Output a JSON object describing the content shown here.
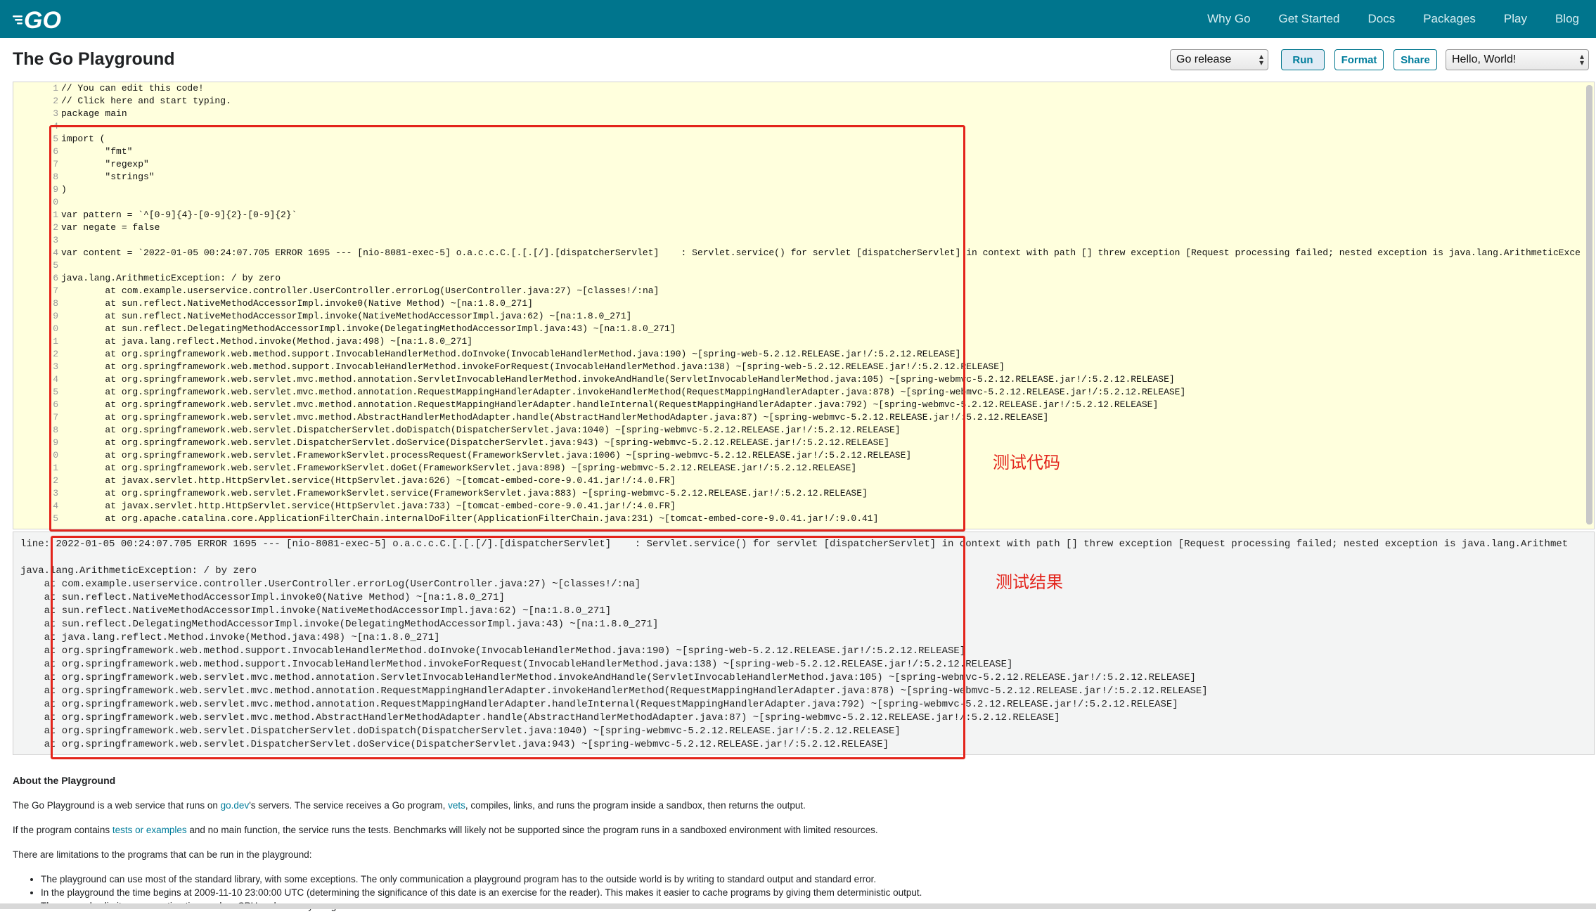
{
  "nav": {
    "logo_text": "GO",
    "items": [
      "Why Go",
      "Get Started",
      "Docs",
      "Packages",
      "Play",
      "Blog"
    ]
  },
  "header": {
    "title": "The Go Playground",
    "release_select": "Go release",
    "run_label": "Run",
    "format_label": "Format",
    "share_label": "Share",
    "example_select": "Hello, World!"
  },
  "editor": {
    "line_numbers": [
      "1",
      "2",
      "3",
      "4",
      "5",
      "6",
      "7",
      "8",
      "9",
      "0",
      "1",
      "2",
      "3",
      "4",
      "5",
      "6",
      "7",
      "8",
      "9",
      "0",
      "1",
      "2",
      "3",
      "4",
      "5",
      "6",
      "7",
      "8",
      "9",
      "0",
      "1",
      "2",
      "3",
      "4",
      "5"
    ],
    "code": "// You can edit this code!\n// Click here and start typing.\npackage main\n\nimport (\n\t\"fmt\"\n\t\"regexp\"\n\t\"strings\"\n)\n\nvar pattern = `^[0-9]{4}-[0-9]{2}-[0-9]{2}`\nvar negate = false\n\nvar content = `2022-01-05 00:24:07.705 ERROR 1695 --- [nio-8081-exec-5] o.a.c.c.C.[.[.[/].[dispatcherServlet]    : Servlet.service() for servlet [dispatcherServlet] in context with path [] threw exception [Request processing failed; nested exception is java.lang.ArithmeticExce\n\njava.lang.ArithmeticException: / by zero\n\tat com.example.userservice.controller.UserController.errorLog(UserController.java:27) ~[classes!/:na]\n\tat sun.reflect.NativeMethodAccessorImpl.invoke0(Native Method) ~[na:1.8.0_271]\n\tat sun.reflect.NativeMethodAccessorImpl.invoke(NativeMethodAccessorImpl.java:62) ~[na:1.8.0_271]\n\tat sun.reflect.DelegatingMethodAccessorImpl.invoke(DelegatingMethodAccessorImpl.java:43) ~[na:1.8.0_271]\n\tat java.lang.reflect.Method.invoke(Method.java:498) ~[na:1.8.0_271]\n\tat org.springframework.web.method.support.InvocableHandlerMethod.doInvoke(InvocableHandlerMethod.java:190) ~[spring-web-5.2.12.RELEASE.jar!/:5.2.12.RELEASE]\n\tat org.springframework.web.method.support.InvocableHandlerMethod.invokeForRequest(InvocableHandlerMethod.java:138) ~[spring-web-5.2.12.RELEASE.jar!/:5.2.12.RELEASE]\n\tat org.springframework.web.servlet.mvc.method.annotation.ServletInvocableHandlerMethod.invokeAndHandle(ServletInvocableHandlerMethod.java:105) ~[spring-webmvc-5.2.12.RELEASE.jar!/:5.2.12.RELEASE]\n\tat org.springframework.web.servlet.mvc.method.annotation.RequestMappingHandlerAdapter.invokeHandlerMethod(RequestMappingHandlerAdapter.java:878) ~[spring-webmvc-5.2.12.RELEASE.jar!/:5.2.12.RELEASE]\n\tat org.springframework.web.servlet.mvc.method.annotation.RequestMappingHandlerAdapter.handleInternal(RequestMappingHandlerAdapter.java:792) ~[spring-webmvc-5.2.12.RELEASE.jar!/:5.2.12.RELEASE]\n\tat org.springframework.web.servlet.mvc.method.AbstractHandlerMethodAdapter.handle(AbstractHandlerMethodAdapter.java:87) ~[spring-webmvc-5.2.12.RELEASE.jar!/:5.2.12.RELEASE]\n\tat org.springframework.web.servlet.DispatcherServlet.doDispatch(DispatcherServlet.java:1040) ~[spring-webmvc-5.2.12.RELEASE.jar!/:5.2.12.RELEASE]\n\tat org.springframework.web.servlet.DispatcherServlet.doService(DispatcherServlet.java:943) ~[spring-webmvc-5.2.12.RELEASE.jar!/:5.2.12.RELEASE]\n\tat org.springframework.web.servlet.FrameworkServlet.processRequest(FrameworkServlet.java:1006) ~[spring-webmvc-5.2.12.RELEASE.jar!/:5.2.12.RELEASE]\n\tat org.springframework.web.servlet.FrameworkServlet.doGet(FrameworkServlet.java:898) ~[spring-webmvc-5.2.12.RELEASE.jar!/:5.2.12.RELEASE]\n\tat javax.servlet.http.HttpServlet.service(HttpServlet.java:626) ~[tomcat-embed-core-9.0.41.jar!/:4.0.FR]\n\tat org.springframework.web.servlet.FrameworkServlet.service(FrameworkServlet.java:883) ~[spring-webmvc-5.2.12.RELEASE.jar!/:5.2.12.RELEASE]\n\tat javax.servlet.http.HttpServlet.service(HttpServlet.java:733) ~[tomcat-embed-core-9.0.41.jar!/:4.0.FR]\n\tat org.apache.catalina.core.ApplicationFilterChain.internalDoFilter(ApplicationFilterChain.java:231) ~[tomcat-embed-core-9.0.41.jar!/:9.0.41]"
  },
  "output": {
    "text": "line: 2022-01-05 00:24:07.705 ERROR 1695 --- [nio-8081-exec-5] o.a.c.c.C.[.[.[/].[dispatcherServlet]    : Servlet.service() for servlet [dispatcherServlet] in context with path [] threw exception [Request processing failed; nested exception is java.lang.Arithmet\n\njava.lang.ArithmeticException: / by zero\n    at com.example.userservice.controller.UserController.errorLog(UserController.java:27) ~[classes!/:na]\n    at sun.reflect.NativeMethodAccessorImpl.invoke0(Native Method) ~[na:1.8.0_271]\n    at sun.reflect.NativeMethodAccessorImpl.invoke(NativeMethodAccessorImpl.java:62) ~[na:1.8.0_271]\n    at sun.reflect.DelegatingMethodAccessorImpl.invoke(DelegatingMethodAccessorImpl.java:43) ~[na:1.8.0_271]\n    at java.lang.reflect.Method.invoke(Method.java:498) ~[na:1.8.0_271]\n    at org.springframework.web.method.support.InvocableHandlerMethod.doInvoke(InvocableHandlerMethod.java:190) ~[spring-web-5.2.12.RELEASE.jar!/:5.2.12.RELEASE]\n    at org.springframework.web.method.support.InvocableHandlerMethod.invokeForRequest(InvocableHandlerMethod.java:138) ~[spring-web-5.2.12.RELEASE.jar!/:5.2.12.RELEASE]\n    at org.springframework.web.servlet.mvc.method.annotation.ServletInvocableHandlerMethod.invokeAndHandle(ServletInvocableHandlerMethod.java:105) ~[spring-webmvc-5.2.12.RELEASE.jar!/:5.2.12.RELEASE]\n    at org.springframework.web.servlet.mvc.method.annotation.RequestMappingHandlerAdapter.invokeHandlerMethod(RequestMappingHandlerAdapter.java:878) ~[spring-webmvc-5.2.12.RELEASE.jar!/:5.2.12.RELEASE]\n    at org.springframework.web.servlet.mvc.method.annotation.RequestMappingHandlerAdapter.handleInternal(RequestMappingHandlerAdapter.java:792) ~[spring-webmvc-5.2.12.RELEASE.jar!/:5.2.12.RELEASE]\n    at org.springframework.web.servlet.mvc.method.AbstractHandlerMethodAdapter.handle(AbstractHandlerMethodAdapter.java:87) ~[spring-webmvc-5.2.12.RELEASE.jar!/:5.2.12.RELEASE]\n    at org.springframework.web.servlet.DispatcherServlet.doDispatch(DispatcherServlet.java:1040) ~[spring-webmvc-5.2.12.RELEASE.jar!/:5.2.12.RELEASE]\n    at org.springframework.web.servlet.DispatcherServlet.doService(DispatcherServlet.java:943) ~[spring-webmvc-5.2.12.RELEASE.jar!/:5.2.12.RELEASE]"
  },
  "annotations": {
    "code_label": "测试代码",
    "result_label": "测试结果"
  },
  "about": {
    "heading": "About the Playground",
    "p1_a": "The Go Playground is a web service that runs on ",
    "p1_link1": "go.dev",
    "p1_b": "'s servers. The service receives a Go program, ",
    "p1_link2": "vets",
    "p1_c": ", compiles, links, and runs the program inside a sandbox, then returns the output.",
    "p2_a": "If the program contains ",
    "p2_link": "tests or examples",
    "p2_b": " and no main function, the service runs the tests. Benchmarks will likely not be supported since the program runs in a sandboxed environment with limited resources.",
    "p3": "There are limitations to the programs that can be run in the playground:",
    "bullets": [
      "The playground can use most of the standard library, with some exceptions. The only communication a playground program has to the outside world is by writing to standard output and standard error.",
      "In the playground the time begins at 2009-11-10 23:00:00 UTC (determining the significance of this date is an exercise for the reader). This makes it easier to cache programs by giving them deterministic output.",
      "There are also limits on execution time and on CPU and memory usage."
    ]
  },
  "colors": {
    "nav_bg": "#00758d",
    "editor_bg": "#ffffdd",
    "annotation_red": "#e3241b",
    "link": "#007d9c"
  }
}
